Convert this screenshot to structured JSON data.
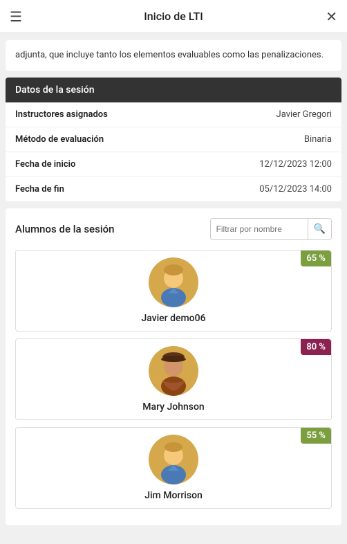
{
  "topbar": {
    "title": "Inicio de LTI",
    "menu_icon": "☰",
    "close_icon": "✕"
  },
  "intro": {
    "text": "adjunta, que incluye tanto los elementos evaluables como las penalizaciones."
  },
  "session": {
    "header": "Datos de la sesión",
    "rows": [
      {
        "label": "Instructores asignados",
        "value": "Javier Gregori"
      },
      {
        "label": "Método de evaluación",
        "value": "Binaria"
      },
      {
        "label": "Fecha de inicio",
        "value": "12/12/2023 12:00"
      },
      {
        "label": "Fecha de fin",
        "value": "05/12/2023 14:00"
      }
    ]
  },
  "students": {
    "title": "Alumnos de la sesión",
    "search_placeholder": "Filtrar por nombre",
    "list": [
      {
        "name": "Javier demo06",
        "score": "65 %",
        "score_class": "score-65",
        "avatar": "male1"
      },
      {
        "name": "Mary Johnson",
        "score": "80 %",
        "score_class": "score-80",
        "avatar": "female1"
      },
      {
        "name": "Jim Morrison",
        "score": "55 %",
        "score_class": "score-65",
        "avatar": "male2"
      }
    ]
  }
}
